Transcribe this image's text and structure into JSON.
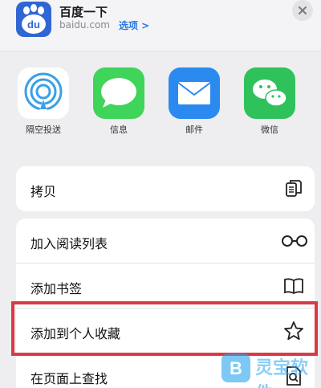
{
  "header": {
    "title": "百度一下",
    "url": "baidu.com",
    "options_label": "选项 >",
    "icon_text": "du"
  },
  "apps": [
    {
      "label": "隔空投送",
      "icon": "airdrop-icon"
    },
    {
      "label": "信息",
      "icon": "messages-icon"
    },
    {
      "label": "邮件",
      "icon": "mail-icon"
    },
    {
      "label": "微信",
      "icon": "wechat-icon"
    }
  ],
  "actions": {
    "copy": {
      "label": "拷贝",
      "icon": "copy-icon"
    },
    "reading_list": {
      "label": "加入阅读列表",
      "icon": "glasses-icon"
    },
    "bookmark": {
      "label": "添加书签",
      "icon": "book-icon"
    },
    "favorites": {
      "label": "添加到个人收藏",
      "icon": "star-icon"
    },
    "find": {
      "label": "在页面上查找",
      "icon": "find-icon"
    }
  },
  "watermark": {
    "text": "灵宝软件"
  },
  "colors": {
    "highlight": "#d93a45",
    "link": "#2a7ae2",
    "messages_green": "#3fd45a",
    "mail_blue": "#2a8af0",
    "wechat_green": "#2fc25b"
  }
}
